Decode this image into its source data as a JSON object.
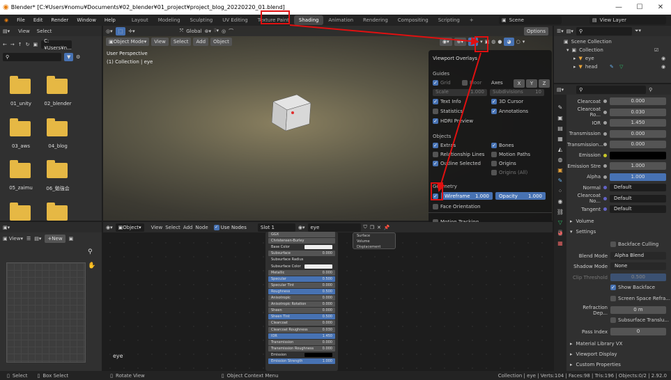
{
  "title": "Blender* [C:¥Users¥nomu¥Documents¥02_blender¥01_project¥project_blog_20220220_01.blend]",
  "menus": [
    "File",
    "Edit",
    "Render",
    "Window",
    "Help"
  ],
  "workspaces": [
    "Layout",
    "Modeling",
    "Sculpting",
    "UV Editing",
    "Texture Paint",
    "Shading",
    "Animation",
    "Rendering",
    "Compositing",
    "Scripting"
  ],
  "active_workspace": "Shading",
  "scene": "Scene",
  "view_layer": "View Layer",
  "filebrowser": {
    "view": "View",
    "select": "Select",
    "path": "C:¥Users¥n...",
    "folders": [
      "01_unity",
      "02_blender",
      "03_aws",
      "04_blog",
      "05_zaimu",
      "06_勉強会",
      "",
      ""
    ]
  },
  "viewport": {
    "mode": "Object Mode",
    "view": "View",
    "select": "Select",
    "add": "Add",
    "object": "Object",
    "orientation": "Global",
    "options": "Options",
    "info1": "User Perspective",
    "info2": "(1) Collection | eye"
  },
  "overlay": {
    "title": "Viewport Overlays",
    "guides": "Guides",
    "grid": "Grid",
    "floor": "Floor",
    "axes": "Axes",
    "x": "X",
    "y": "Y",
    "z": "Z",
    "scale": "Scale",
    "scale_val": "1.000",
    "subdiv": "Subdivisions",
    "subdiv_val": "10",
    "text_info": "Text Info",
    "cursor": "3D Cursor",
    "statistics": "Statistics",
    "annotations": "Annotations",
    "hdri": "HDRI Preview",
    "objects": "Objects",
    "extras": "Extras",
    "bones": "Bones",
    "rel": "Relationship Lines",
    "motion": "Motion Paths",
    "outline": "Outline Selected",
    "origins": "Origins",
    "origins_all": "Origins (All)",
    "geometry": "Geometry",
    "wireframe": "Wireframe",
    "wire_val": "1.000",
    "opacity": "Opacity",
    "opacity_val": "1.000",
    "face_orient": "Face Orientation",
    "motion_tracking": "Motion Tracking"
  },
  "outliner": {
    "scene_collection": "Scene Collection",
    "collection": "Collection",
    "items": [
      "eye",
      "head"
    ]
  },
  "props": [
    {
      "label": "Clearcoat",
      "value": "0.000",
      "style": ""
    },
    {
      "label": "Clearcoat Ro...",
      "value": "0.030",
      "style": ""
    },
    {
      "label": "IOR",
      "value": "1.450",
      "style": ""
    },
    {
      "label": "Transmission",
      "value": "0.000",
      "style": ""
    },
    {
      "label": "Transmission...",
      "value": "0.000",
      "style": ""
    },
    {
      "label": "Emission",
      "value": "",
      "style": "black"
    },
    {
      "label": "Emission Stre",
      "value": "1.000",
      "style": ""
    },
    {
      "label": "Alpha",
      "value": "1.000",
      "style": "blue"
    },
    {
      "label": "Normal",
      "value": "Default",
      "style": "dark"
    },
    {
      "label": "Clearcoat No...",
      "value": "Default",
      "style": "dark"
    },
    {
      "label": "Tangent",
      "value": "Default",
      "style": "dark"
    }
  ],
  "settings": {
    "volume": "Volume",
    "settings": "Settings",
    "backface": "Backface Culling",
    "blend_mode": "Blend Mode",
    "blend_val": "Alpha Blend",
    "shadow_mode": "Shadow Mode",
    "shadow_val": "None",
    "clip": "Clip Threshold",
    "clip_val": "0.500",
    "show_backface": "Show Backface",
    "ssr": "Screen Space Refra...",
    "refr_depth": "Refraction Dep...",
    "refr_val": "0 m",
    "sss": "Subsurface Translu...",
    "pass_index": "Pass Index",
    "pass_val": "0",
    "matlib": "Material Library VX",
    "vp_display": "Viewport Display",
    "custom": "Custom Properties"
  },
  "node_editor": {
    "object": "Object",
    "view": "View",
    "select": "Select",
    "add": "Add",
    "node": "Node",
    "use_nodes": "Use Nodes",
    "slot": "Slot 1",
    "material": "eye",
    "label": "eye",
    "rows": [
      [
        "GGX",
        ""
      ],
      [
        "Christensen-Burley",
        ""
      ],
      [
        "Base Color",
        ""
      ],
      [
        "Subsurface",
        "0.000"
      ],
      [
        "Subsurface Radius",
        ""
      ],
      [
        "Subsurface Color",
        ""
      ],
      [
        "Metallic",
        "0.000"
      ],
      [
        "Specular",
        "0.500"
      ],
      [
        "Specular Tint",
        "0.000"
      ],
      [
        "Roughness",
        "0.500"
      ],
      [
        "Anisotropic",
        "0.000"
      ],
      [
        "Anisotropic Rotation",
        "0.000"
      ],
      [
        "Sheen",
        "0.000"
      ],
      [
        "Sheen Tint",
        "0.500"
      ],
      [
        "Clearcoat",
        "0.000"
      ],
      [
        "Clearcoat Roughness",
        "0.030"
      ],
      [
        "IOR",
        "1.450"
      ],
      [
        "Transmission",
        "0.000"
      ],
      [
        "Transmission Roughness",
        "0.000"
      ],
      [
        "Emission",
        ""
      ],
      [
        "Emission Strength",
        "1.000"
      ]
    ],
    "out_rows": [
      "Surface",
      "Volume",
      "Displacement"
    ]
  },
  "imgeditor": {
    "view": "View",
    "new": "New"
  },
  "status": {
    "select": "Select",
    "box_select": "Box Select",
    "rotate": "Rotate View",
    "context": "Object Context Menu",
    "info": "Collection | eye | Verts:104 | Faces:98 | Tris:196 | Objects:0/2 | 2.92.0"
  }
}
